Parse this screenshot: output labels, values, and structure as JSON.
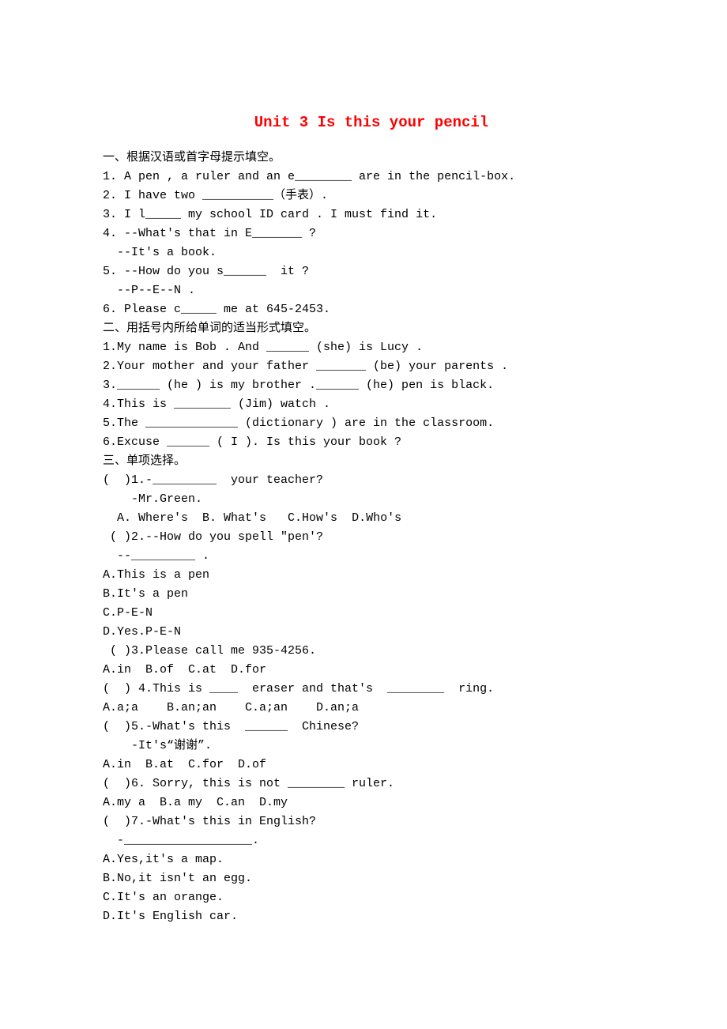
{
  "title": "Unit 3 Is this your pencil",
  "lines": [
    "一、根据汉语或首字母提示填空。",
    "1. A pen , a ruler and an e________ are in the pencil-box.",
    "2. I have two __________（手表）.",
    "3. I l_____ my school ID card . I must find it.",
    "4. --What's that in E_______ ?",
    "  --It's a book.",
    "5. --How do you s______  it ?",
    "  --P--E--N .",
    "6. Please c_____ me at 645-2453.",
    "二、用括号内所给单词的适当形式填空。",
    "1.My name is Bob . And ______ (she) is Lucy .",
    "2.Your mother and your father _______ (be) your parents .",
    "3.______ (he ) is my brother .______ (he) pen is black.",
    "4.This is ________ (Jim) watch .",
    "5.The _____________ (dictionary ) are in the classroom.",
    "6.Excuse ______ ( I ). Is this your book ?",
    "三、单项选择。",
    "(  )1.-_________  your teacher?",
    "    -Mr.Green.",
    "  A. Where's  B. What's   C.How's  D.Who's",
    " ( )2.--How do you spell \"pen'?",
    "  --_________ .",
    "A.This is a pen",
    "B.It's a pen",
    "C.P-E-N",
    "D.Yes.P-E-N",
    " ( )3.Please call me 935-4256.",
    "A.in  B.of  C.at  D.for",
    "(  ) 4.This is ____  eraser and that's  ________  ring.",
    "A.a;a    B.an;an    C.a;an    D.an;a",
    "(  )5.-What's this  ______  Chinese?",
    "    -It's“谢谢”.",
    "A.in  B.at  C.for  D.of",
    "(  )6. Sorry, this is not ________ ruler.",
    "A.my a  B.a my  C.an  D.my",
    "(  )7.-What's this in English?",
    "  -__________________.",
    "A.Yes,it's a map.",
    "B.No,it isn't an egg.",
    "C.It's an orange.",
    "D.It's English car."
  ]
}
